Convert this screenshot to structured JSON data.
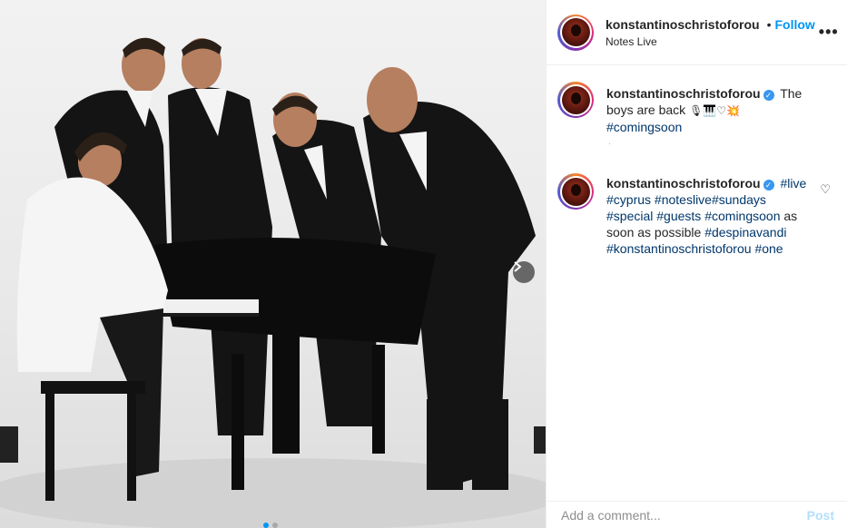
{
  "post": {
    "media_alt": "",
    "carousel_next_icon": "chevron-right-icon",
    "carousel_count": 2,
    "carousel_active": 0
  },
  "header": {
    "username": "konstantinoschristoforou",
    "bullet": "•",
    "follow_label": "Follow",
    "location": "Notes Live",
    "more_icon": "ellipsis-icon",
    "more_label": "•••"
  },
  "caption": {
    "username": "konstantinoschristoforou",
    "text": "The boys are back",
    "emojis": "🎙🎹♡💥",
    "hashtags": [
      "#comingsoon"
    ]
  },
  "comments": [
    {
      "username": "konstantinoschristoforou",
      "parts": [
        {
          "t": "tag",
          "v": "#live"
        },
        {
          "t": "tag",
          "v": "#cyprus"
        },
        {
          "t": "tag",
          "v": "#noteslive"
        },
        {
          "t": "tag",
          "v": "#sundays"
        },
        {
          "t": "tag",
          "v": "#special"
        },
        {
          "t": "tag",
          "v": "#guests"
        },
        {
          "t": "tag",
          "v": "#comingsoon"
        },
        {
          "t": "text",
          "v": "as soon as possible"
        },
        {
          "t": "tag",
          "v": "#despinavandi"
        },
        {
          "t": "tag",
          "v": "#konstantinoschristoforou"
        },
        {
          "t": "tag",
          "v": "#one"
        }
      ],
      "heart_icon": "heart-outline-icon"
    }
  ],
  "composer": {
    "placeholder": "Add a comment...",
    "post_label": "Post"
  },
  "colors": {
    "link_blue": "#0095f6",
    "hashtag": "#00376b",
    "verified": "#3897f0",
    "post_disabled": "#b2dffc"
  }
}
